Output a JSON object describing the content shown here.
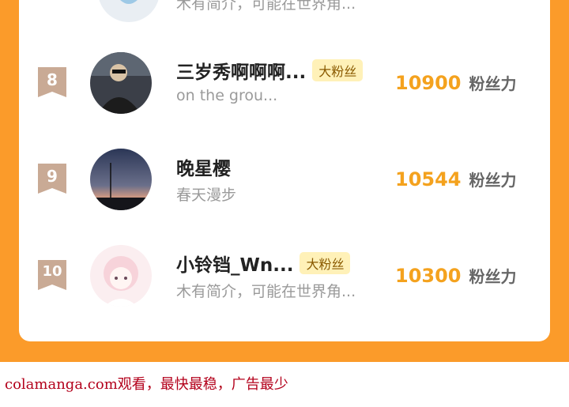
{
  "previous_row": {
    "bio": "木有简介，可能在世界角..."
  },
  "rows": [
    {
      "rank": "8",
      "name": "三岁秀啊啊啊...",
      "tag": "大粉丝",
      "bio": "on the grou...",
      "score": "10900",
      "unit": "粉丝力"
    },
    {
      "rank": "9",
      "name": "晚星樱",
      "tag": "",
      "bio": "春天漫步",
      "score": "10544",
      "unit": "粉丝力"
    },
    {
      "rank": "10",
      "name": "小铃铛_Wn...",
      "tag": "大粉丝",
      "bio": "木有简介，可能在世界角...",
      "score": "10300",
      "unit": "粉丝力"
    }
  ],
  "footer": "colamanga.com观看，最快最稳，广告最少",
  "colors": {
    "frame": "#fb9b2a",
    "score": "#f4a21e",
    "tag_bg": "#fff1b8",
    "footer": "#b3001b"
  }
}
